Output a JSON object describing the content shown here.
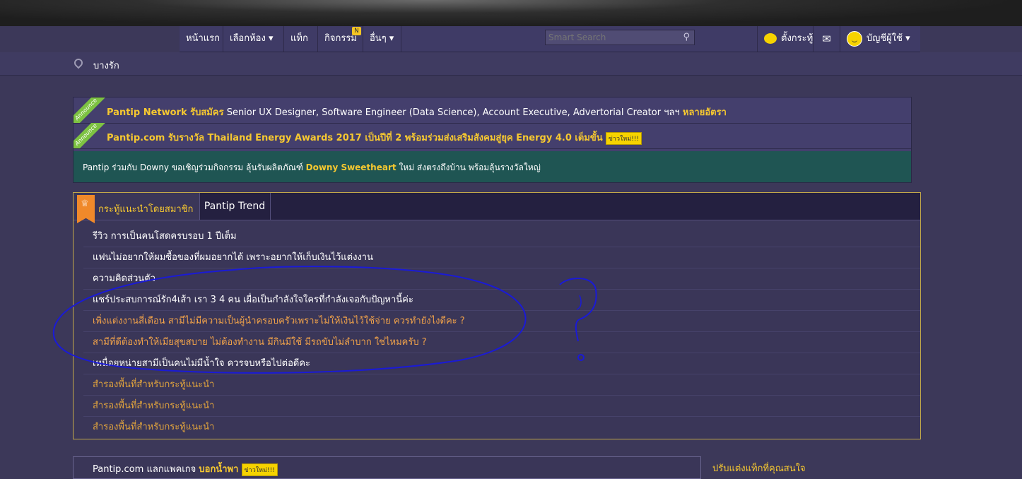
{
  "nav": {
    "home": "หน้าแรก",
    "rooms": "เลือกห้อง ▾",
    "tags": "แท็ก",
    "activities": "กิจกรรม",
    "activities_badge": "N",
    "more": "อื่นๆ ▾",
    "search_placeholder": "Smart Search",
    "post": "ตั้งกระทู้",
    "account": "บัญชีผู้ใช้ ▾"
  },
  "breadcrumb": "บางรัก",
  "announcements": [
    {
      "ribbon": "Announce",
      "brand": "Pantip Network รับสมัคร",
      "text": " Senior UX Designer, Software Engineer (Data Science), Account Executive, Advertorial Creator ฯลฯ ",
      "tail": "หลายอัตรา"
    },
    {
      "ribbon": "Announce",
      "brand": "Pantip.com รับรางวัล Thailand Energy Awards 2017 เป็นปีที่ 2 พร้อมร่วมส่งเสริมสังคมสู่ยุค Energy 4.0 เต็มขั้น",
      "badge": "ข่าวใหม่!!!"
    }
  ],
  "promo": {
    "pre": "Pantip ร่วมกับ Downy ขอเชิญร่วมกิจกรรม ลุ้นรับผลิตภัณฑ์ ",
    "highlight": "Downy Sweetheart",
    "post": " ใหม่ ส่งตรงถึงบ้าน พร้อมลุ้นรางวัลใหญ่"
  },
  "recommend": {
    "tab_active": "กระทู้แนะนำโดยสมาชิก",
    "tab_other": "Pantip Trend",
    "items": [
      "รีวิว การเป็นคนโสดครบรอบ 1 ปีเต็ม",
      "แฟนไม่อยากให้ผมซื้อของที่ผมอยากได้ เพราะอยากให้เก็บเงินไว้แต่งงาน",
      "ความคิดส่วนตัว",
      "แชร์ประสบการณ์รัก4เส้า เรา 3 4 คน เผื่อเป็นกำลังใจใครที่กำลังเจอกับปัญหานี้ค่ะ",
      "เพิ่งแต่งงานสี่เดือน สามีไม่มีความเป็นผู้นำครอบครัวเพราะไม่ให้เงินไว้ใช้จ่าย ควรทำยังไงดีคะ ?",
      "สามีที่ดีต้องทำให้เมียสุขสบาย ไม่ต้องทำงาน มีกินมีใช้ มีรถขับไม่ลำบาก ใช่ไหมครับ ?",
      "เหนื่อยหน่ายสามีเป็นคนไม่มีน้ำใจ ควรจบหรือไปต่อดีคะ",
      "สำรองพื้นที่สำหรับกระทู้แนะนำ",
      "สำรองพื้นที่สำหรับกระทู้แนะนำ",
      "สำรองพื้นที่สำหรับกระทู้แนะนำ"
    ]
  },
  "bottom": {
    "pre": "Pantip.com แลกแพคเกจ ",
    "highlight": "บอกน้ำพา",
    "badge": "ข่าวใหม่!!!",
    "side_link": "ปรับแต่งแท็กที่คุณสนใจ"
  },
  "colors": {
    "background": "#3c3859",
    "nav": "#3f3b66",
    "accent_yellow": "#f6c830",
    "orange_link": "#f2a34a",
    "teal": "#1f5553",
    "annotation_ink": "#1a1ad6"
  }
}
